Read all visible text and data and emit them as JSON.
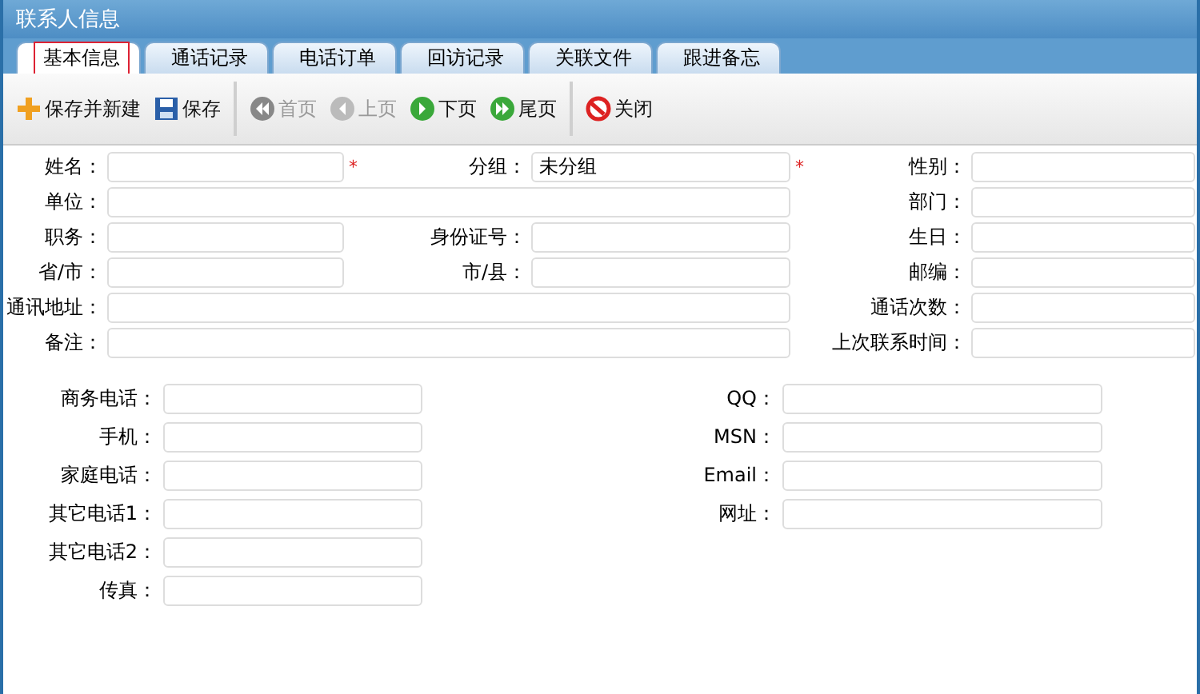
{
  "window": {
    "title": "联系人信息"
  },
  "tabs": [
    {
      "label": "基本信息",
      "selected": true
    },
    {
      "label": "通话记录",
      "selected": false
    },
    {
      "label": "电话订单",
      "selected": false
    },
    {
      "label": "回访记录",
      "selected": false
    },
    {
      "label": "关联文件",
      "selected": false
    },
    {
      "label": "跟进备忘",
      "selected": false
    }
  ],
  "toolbar": [
    [
      {
        "kind": "add",
        "label": "保存并新建",
        "disabled": false
      },
      {
        "kind": "save",
        "label": "保存",
        "disabled": false
      }
    ],
    [
      {
        "kind": "first",
        "label": "首页",
        "disabled": true
      },
      {
        "kind": "prev",
        "label": "上页",
        "disabled": true
      },
      {
        "kind": "next",
        "label": "下页",
        "disabled": false
      },
      {
        "kind": "last",
        "label": "尾页",
        "disabled": false
      }
    ],
    [
      {
        "kind": "close",
        "label": "关闭",
        "disabled": false
      }
    ]
  ],
  "form": {
    "required_mark": "*",
    "rows": [
      [
        {
          "label": "姓名：",
          "kind": "short",
          "required": true
        },
        {
          "label": "分组：",
          "kind": "short",
          "value": "未分组",
          "required": true
        },
        {
          "label": "性别：",
          "kind": "short",
          "required": false
        }
      ],
      [
        {
          "label": "单位：",
          "kind": "wide",
          "required": false
        },
        {
          "label": "部门：",
          "kind": "short",
          "required": false
        }
      ],
      [
        {
          "label": "职务：",
          "kind": "short",
          "required": false
        },
        {
          "label": "身份证号：",
          "kind": "short",
          "required": false
        },
        {
          "label": "生日：",
          "kind": "short",
          "required": false
        }
      ],
      [
        {
          "label": "省/市：",
          "kind": "short",
          "required": false
        },
        {
          "label": "市/县：",
          "kind": "short",
          "required": false
        },
        {
          "label": "邮编：",
          "kind": "short",
          "required": false
        }
      ],
      [
        {
          "label": "通讯地址：",
          "kind": "wide",
          "required": false
        },
        {
          "label": "通话次数：",
          "kind": "short",
          "required": false
        }
      ],
      [
        {
          "label": "备注：",
          "kind": "wide",
          "required": false
        },
        {
          "label": "上次联系时间：",
          "kind": "short",
          "required": false
        }
      ]
    ]
  },
  "contacts": {
    "left": [
      {
        "label": "商务电话："
      },
      {
        "label": "手机："
      },
      {
        "label": "家庭电话："
      },
      {
        "label": "其它电话1："
      },
      {
        "label": "其它电话2："
      },
      {
        "label": "传真："
      }
    ],
    "right": [
      {
        "label": "QQ："
      },
      {
        "label": "MSN："
      },
      {
        "label": "Email："
      },
      {
        "label": "网址："
      }
    ]
  }
}
